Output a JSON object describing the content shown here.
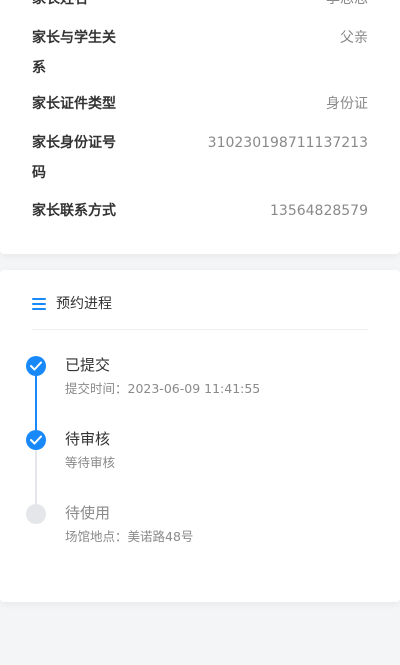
{
  "parent_info": {
    "rows": [
      {
        "label": "家长姓名",
        "value": "李思思"
      },
      {
        "label": "家长与学生关系",
        "value": "父亲"
      },
      {
        "label": "家长证件类型",
        "value": "身份证"
      },
      {
        "label": "家长身份证号码",
        "value": "310230198711137213"
      },
      {
        "label": "家长联系方式",
        "value": "13564828579"
      }
    ]
  },
  "progress": {
    "icon": "menu-list-icon",
    "title": "预约进程",
    "steps": [
      {
        "title": "已提交",
        "desc": "提交时间：2023-06-09 11:41:55",
        "status": "done"
      },
      {
        "title": "待审核",
        "desc": "等待审核",
        "status": "done"
      },
      {
        "title": "待使用",
        "desc": "场馆地点：美诺路48号",
        "status": "todo"
      }
    ]
  },
  "colors": {
    "accent": "#1989fa",
    "inactive_dot": "#e4e6ea",
    "label_text": "#333333",
    "value_text": "#8a8a8a"
  }
}
